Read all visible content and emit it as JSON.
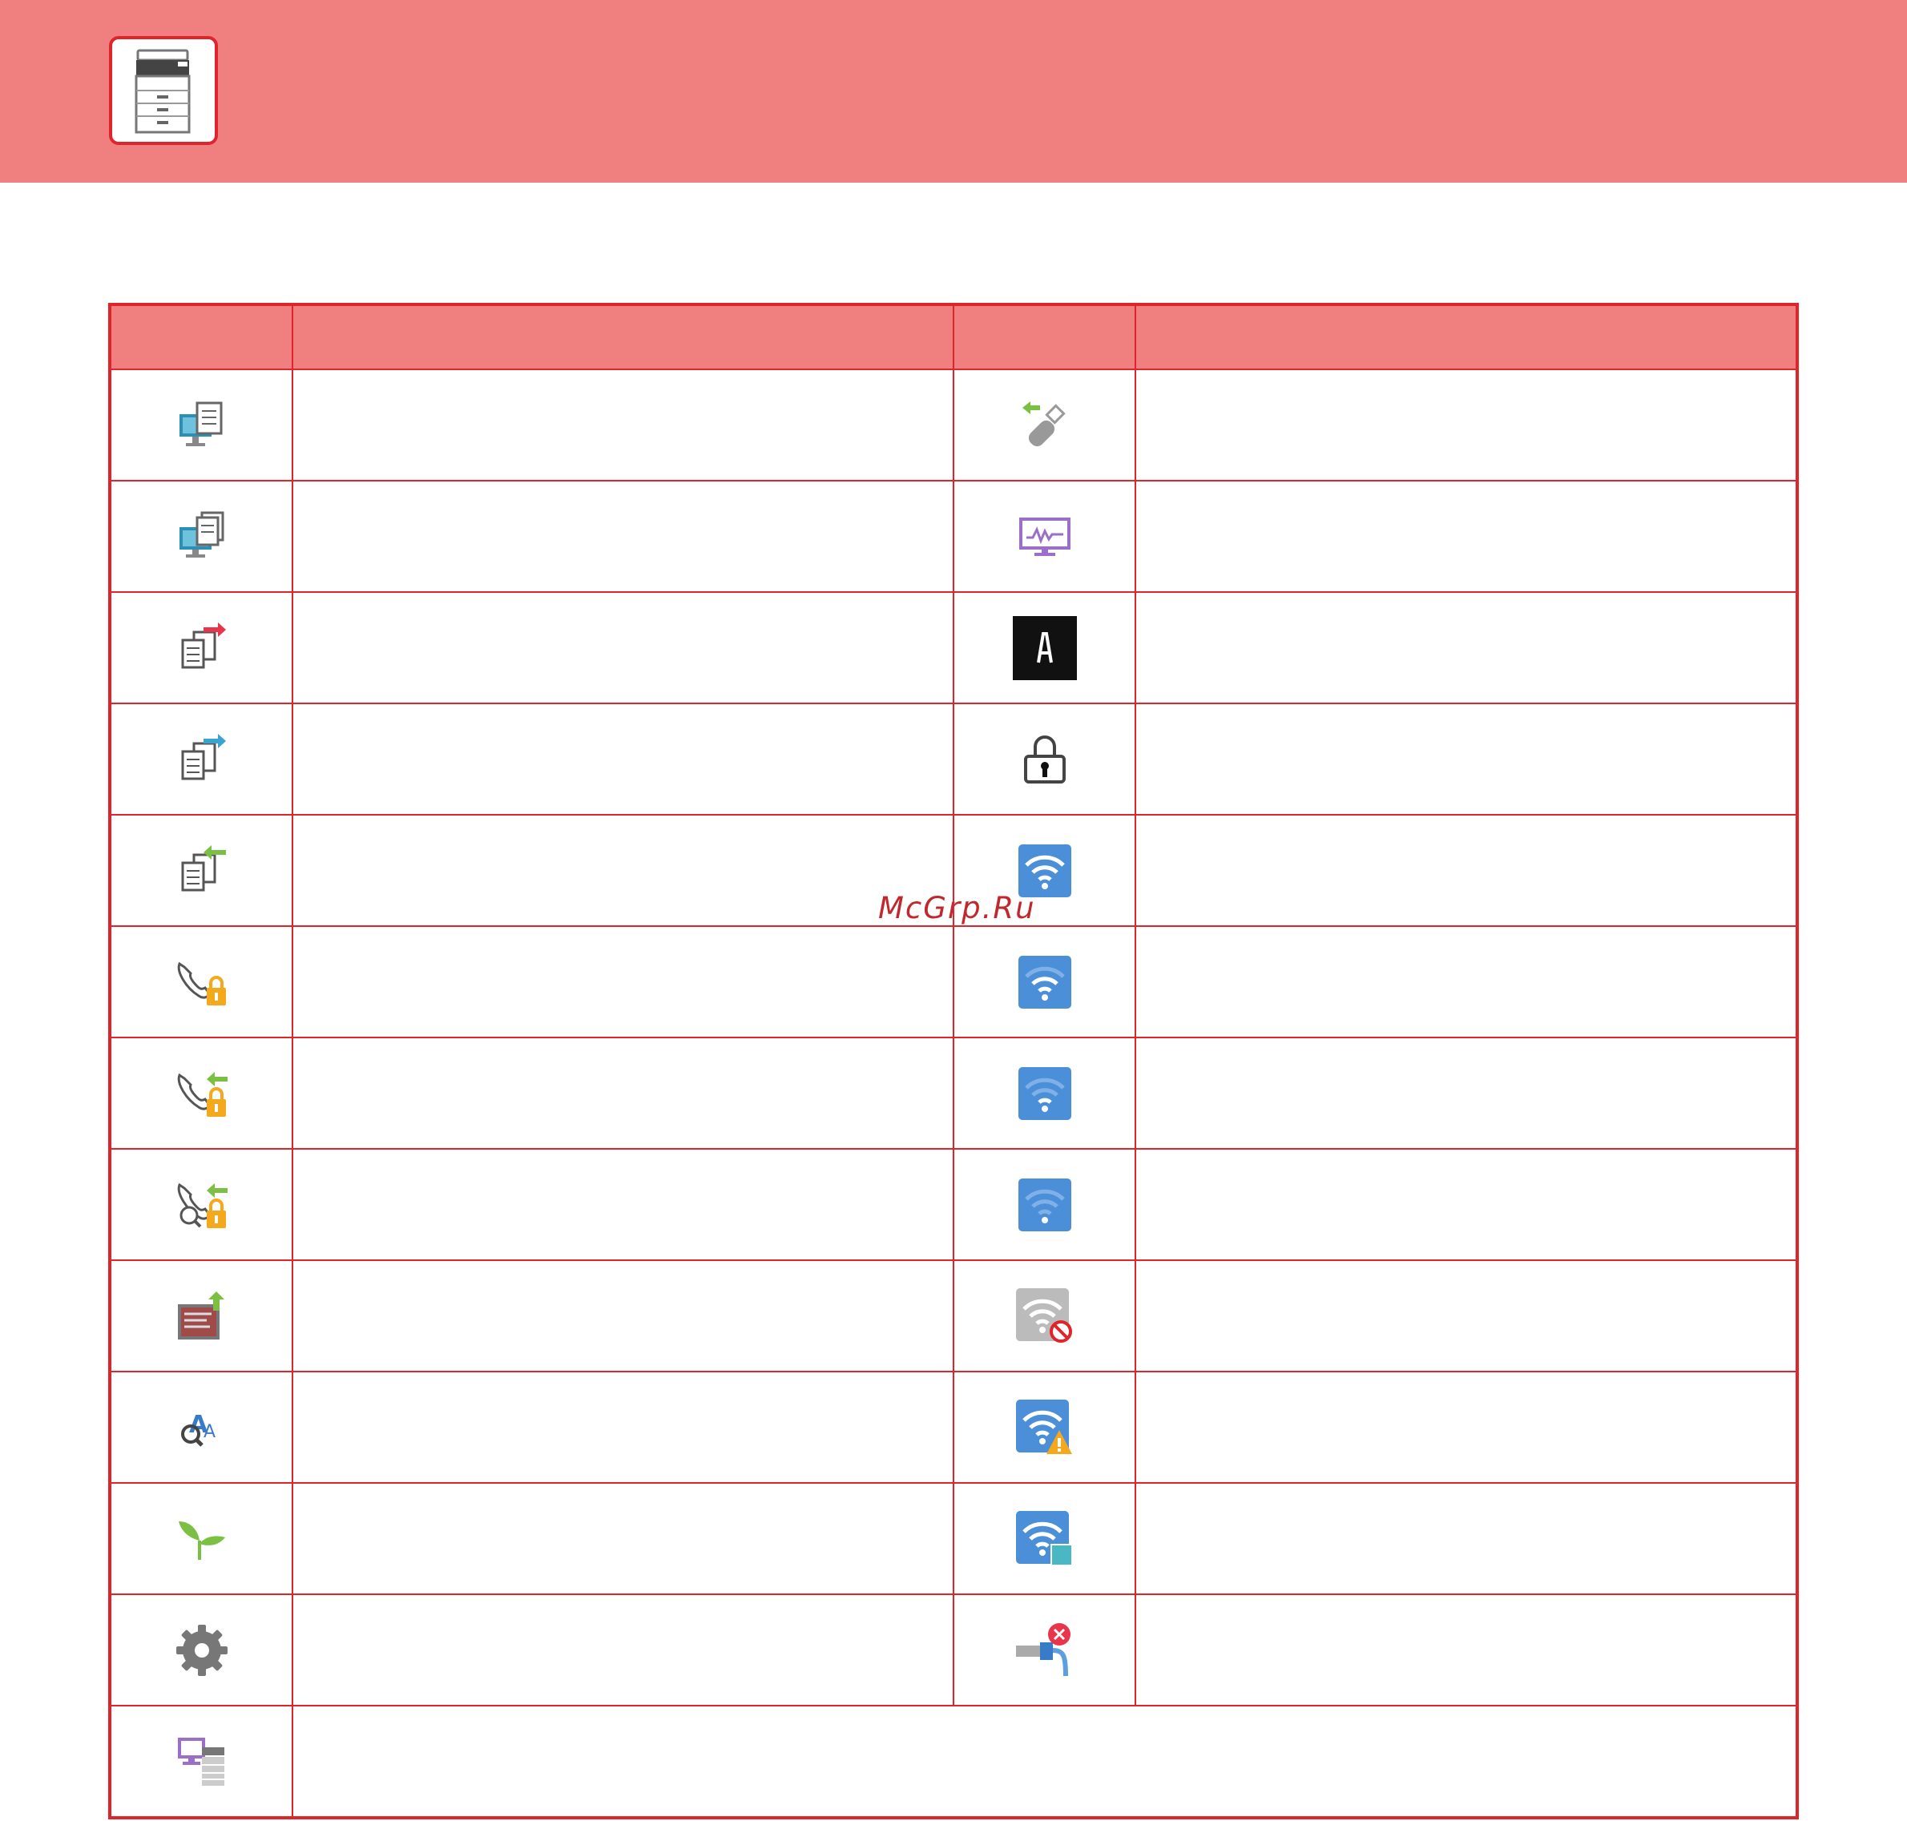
{
  "watermark": "McGrp.Ru",
  "colors": {
    "header": "#f08080",
    "border": "#e0242c"
  },
  "header": {
    "icon": "printer-icon"
  },
  "table": {
    "rows": [
      {
        "left": "pc-document-icon",
        "right": "usb-memory-icon"
      },
      {
        "left": "pc-documents-icon",
        "right": "monitor-activity-icon"
      },
      {
        "left": "documents-send-red-icon",
        "right": "letter-a-icon"
      },
      {
        "left": "documents-send-blue-icon",
        "right": "lock-icon"
      },
      {
        "left": "documents-receive-green-icon",
        "right": "wifi-full-icon"
      },
      {
        "left": "fax-lock-icon",
        "right": "wifi-three-bars-icon"
      },
      {
        "left": "fax-receive-lock-icon",
        "right": "wifi-two-bars-icon"
      },
      {
        "left": "fax-search-lock-icon",
        "right": "wifi-one-bar-icon"
      },
      {
        "left": "image-upload-icon",
        "right": "wifi-disabled-icon"
      },
      {
        "left": "ocr-text-icon",
        "right": "wifi-warning-icon"
      },
      {
        "left": "eco-sprout-icon",
        "right": "wifi-access-point-icon"
      },
      {
        "left": "gear-icon",
        "right": "lan-disconnected-icon"
      },
      {
        "left": "remote-pc-printer-icon"
      }
    ]
  }
}
